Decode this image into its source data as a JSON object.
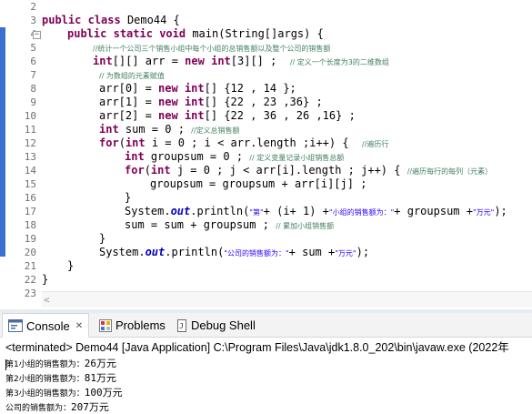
{
  "editor": {
    "gutter_lines": [
      "2",
      "3",
      "4",
      "5",
      "6",
      "7",
      "8",
      "9",
      "10",
      "11",
      "12",
      "13",
      "14",
      "15",
      "16",
      "17",
      "18",
      "19",
      "20",
      "21",
      "22",
      "23"
    ]
  },
  "code": {
    "l2": "",
    "l3_kw1": "public",
    "l3_kw2": "class",
    "l3_rest": " Demo44 {",
    "l4_kw1": "public",
    "l4_kw2": "static",
    "l4_kw3": "void",
    "l4_rest": " main(String[]args) {",
    "l5_cm": "//统计一个公司三个销售小组中每个小组的总销售额以及整个公司的销售额",
    "l6_kw1": "int",
    "l6_mid1": "[][] arr = ",
    "l6_kw2": "new",
    "l6_kw3": "int",
    "l6_mid2": "[3][] ;  ",
    "l6_cm": "// 定义一个长度为3的二维数组",
    "l7_cm": "// 为数组的元素赋值",
    "l8_a": "arr[0] = ",
    "l8_kw1": "new",
    "l8_kw2": "int",
    "l8_b": "[] {12 , 14 };",
    "l9_a": "arr[1] = ",
    "l9_kw1": "new",
    "l9_kw2": "int",
    "l9_b": "[] {22 , 23 ,36} ;",
    "l10_a": "arr[2] = ",
    "l10_kw1": "new",
    "l10_kw2": "int",
    "l10_b": "[] {22 , 36 , 26 ,16} ;",
    "l11_kw": "int",
    "l11_a": " sum = 0 ; ",
    "l11_cm": "//定义总销售额",
    "l12_kw1": "for",
    "l12_a": "(",
    "l12_kw2": "int",
    "l12_b": " i = 0 ; i < arr.length ;i++) {  ",
    "l12_cm": "//遍历行",
    "l13_kw": "int",
    "l13_a": " groupsum = 0 ; ",
    "l13_cm": "// 定义变量记录小组销售总额",
    "l14_kw1": "for",
    "l14_a": "(",
    "l14_kw2": "int",
    "l14_b": " j = 0 ; j < arr[i].length ; j++) { ",
    "l14_cm": "//遍历每行的每列（元素）",
    "l15": "groupsum = groupsum + arr[i][j] ;",
    "l16": "}",
    "l17_a": "System.",
    "l17_fld": "out",
    "l17_b": ".println(",
    "l17_s1": "\"第\"",
    "l17_c": "+ (i+ 1) +",
    "l17_s2": "\"小组的销售额为：\"",
    "l17_d": "+ groupsum +",
    "l17_s3": "\"万元\"",
    "l17_e": ");",
    "l18_a": "sum = sum + groupsum ; ",
    "l18_cm": "// 累加小组销售额",
    "l19": "}",
    "l20_a": "System.",
    "l20_fld": "out",
    "l20_b": ".println(",
    "l20_s1": "\"公司的销售额为：\"",
    "l20_c": "+ sum +",
    "l20_s2": "\"万元\"",
    "l20_d": ");",
    "l21": "}",
    "l22": "}",
    "l23": ""
  },
  "tabs": {
    "console": "Console",
    "problems": "Problems",
    "debug_shell": "Debug Shell"
  },
  "status": {
    "text": "<terminated> Demo44 [Java Application] C:\\Program Files\\Java\\jdk1.8.0_202\\bin\\javaw.exe (2022年"
  },
  "output": {
    "line1_a": "第1小组的销售额为：",
    "line1_b": "26万元",
    "line2_a": "第2小组的销售额为：",
    "line2_b": "81万元",
    "line3_a": "第3小组的销售额为：",
    "line3_b": "100万元",
    "line4_a": "公司的销售额为：",
    "line4_b": "207万元"
  },
  "colors": {
    "keyword": "#7f0055",
    "comment": "#3f7f5f",
    "string": "#2a00ff",
    "field": "#0000c0",
    "ruler_mark": "#3b6fd0"
  },
  "icons": [
    "fold-minus-icon",
    "console-icon",
    "close-icon",
    "problems-icon",
    "debug-shell-icon",
    "scroll-left-icon"
  ]
}
